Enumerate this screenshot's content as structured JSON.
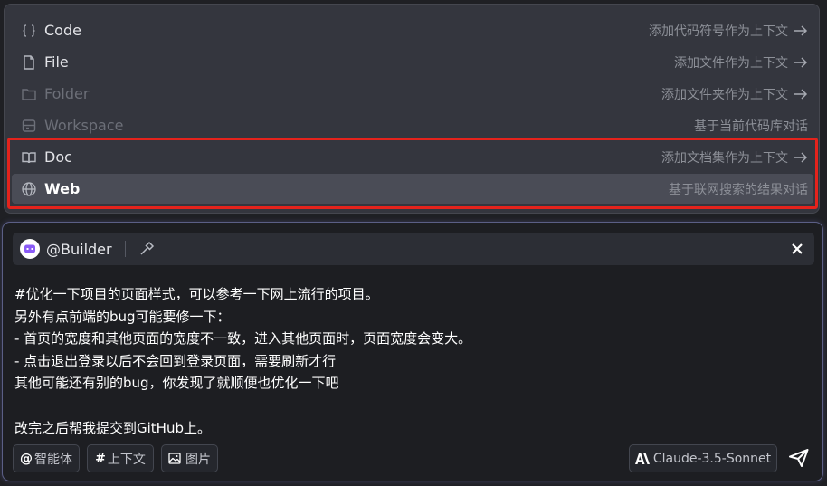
{
  "menu": {
    "items": [
      {
        "label": "Code",
        "desc": "添加代码符号作为上下文",
        "icon": "code-braces-icon",
        "has_arrow": true
      },
      {
        "label": "File",
        "desc": "添加文件作为上下文",
        "icon": "file-icon",
        "has_arrow": true
      },
      {
        "label": "Folder",
        "desc": "添加文件夹作为上下文",
        "icon": "folder-icon",
        "has_arrow": true
      },
      {
        "label": "Workspace",
        "desc": "基于当前代码库对话",
        "icon": "workspace-icon",
        "has_arrow": false
      },
      {
        "label": "Doc",
        "desc": "添加文档集作为上下文",
        "icon": "book-icon",
        "has_arrow": true
      },
      {
        "label": "Web",
        "desc": "基于联网搜索的结果对话",
        "icon": "globe-icon",
        "has_arrow": false
      }
    ],
    "highlight_color": "#e4231c"
  },
  "chat": {
    "agent": {
      "name": "@Builder",
      "avatar_color": "#8b5cf6"
    },
    "message_lines": [
      "#优化一下项目的页面样式，可以参考一下网上流行的项目。",
      "另外有点前端的bug可能要修一下：",
      "- 首页的宽度和其他页面的宽度不一致，进入其他页面时，页面宽度会变大。",
      "- 点击退出登录以后不会回到登录页面，需要刷新才行",
      "其他可能还有别的bug，你发现了就顺便也优化一下吧",
      "",
      "改完之后帮我提交到GitHub上。"
    ],
    "buttons": {
      "agent": {
        "glyph": "@",
        "label": "智能体"
      },
      "context": {
        "glyph": "#",
        "label": "上下文"
      },
      "image": {
        "label": "图片"
      }
    },
    "model": {
      "label": "Claude-3.5-Sonnet"
    }
  }
}
